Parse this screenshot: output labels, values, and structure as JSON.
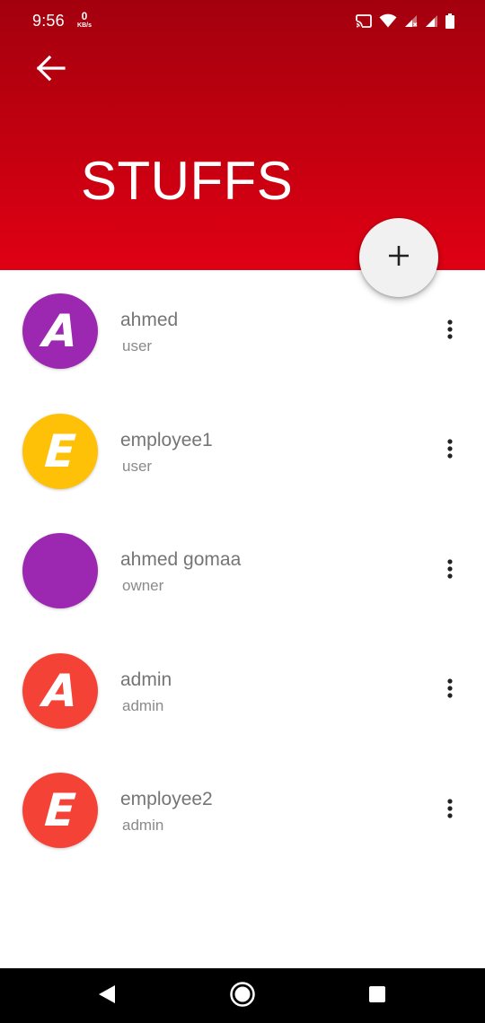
{
  "status_bar": {
    "time": "9:56",
    "net_speed_value": "0",
    "net_speed_unit": "KB/s",
    "icons": [
      "cast-icon",
      "wifi-icon",
      "signal-no-data-icon",
      "signal-icon",
      "battery-icon"
    ]
  },
  "header": {
    "title": "STUFFS",
    "back_icon": "arrow-left-icon",
    "background_top": "#a3000e",
    "background_bottom": "#e00014"
  },
  "fab": {
    "icon": "plus-icon",
    "background": "#f1f1f1"
  },
  "users": [
    {
      "name": "ahmed",
      "role": "user",
      "avatar_letter": "A",
      "avatar_color": "#9c27b0"
    },
    {
      "name": "employee1",
      "role": "user",
      "avatar_letter": "E",
      "avatar_color": "#ffc107"
    },
    {
      "name": "ahmed gomaa",
      "role": "owner",
      "avatar_letter": "",
      "avatar_color": "#9c27b0"
    },
    {
      "name": "admin",
      "role": "admin",
      "avatar_letter": "A",
      "avatar_color": "#f44336"
    },
    {
      "name": "employee2",
      "role": "admin",
      "avatar_letter": "E",
      "avatar_color": "#f44336"
    }
  ],
  "nav_bar": {
    "buttons": [
      "back-triangle-icon",
      "home-circle-icon",
      "recents-square-icon"
    ]
  }
}
